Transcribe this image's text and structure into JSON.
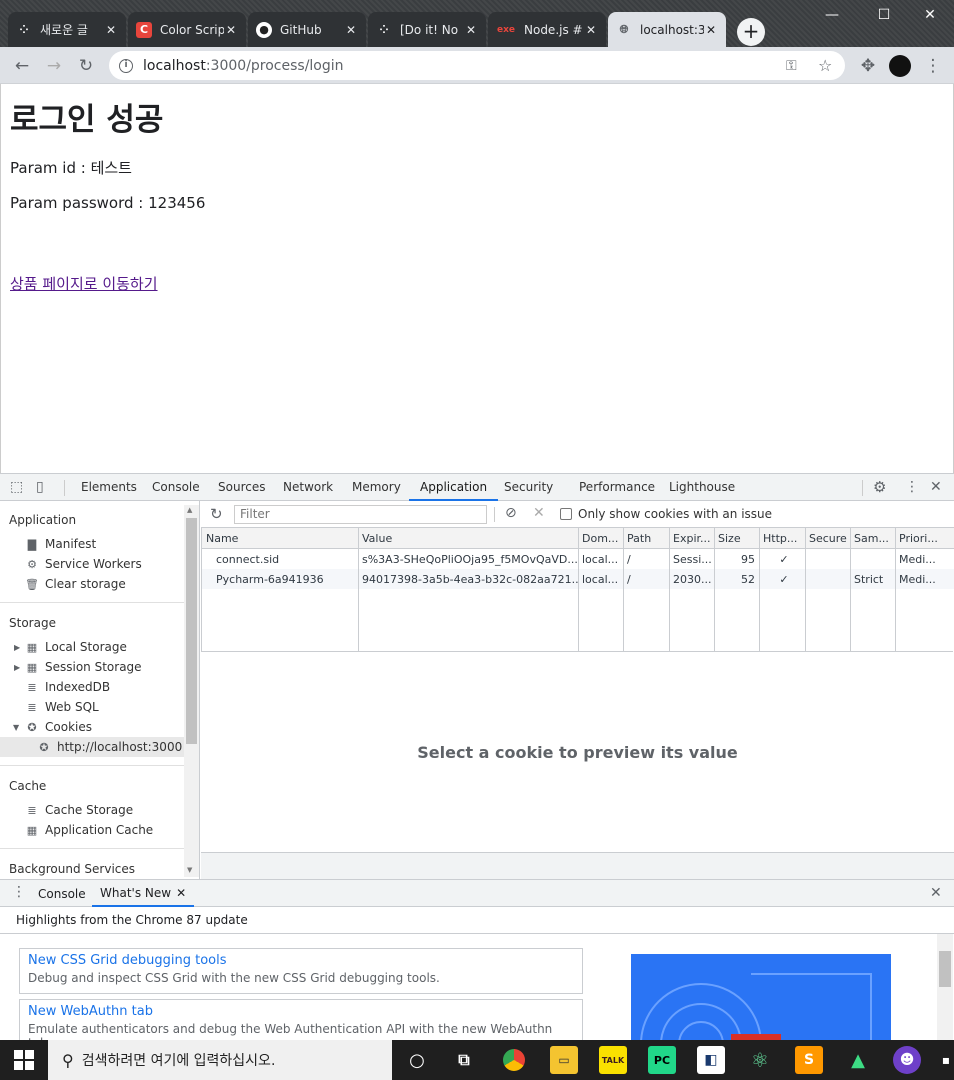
{
  "browser": {
    "tabs": [
      {
        "title": "새로운 글",
        "icon_name": "tistory-icon"
      },
      {
        "title": "Color Scrip",
        "icon_name": "colorscripter-icon"
      },
      {
        "title": "GitHub",
        "icon_name": "github-icon"
      },
      {
        "title": "[Do it! No",
        "icon_name": "tistory-icon"
      },
      {
        "title": "Node.js #",
        "icon_name": "exe-icon",
        "icon_text": "exe"
      },
      {
        "title": "localhost:3",
        "icon_name": "globe-icon",
        "active": true
      }
    ],
    "url_host": "localhost",
    "url_path": ":3000/process/login"
  },
  "page": {
    "heading": "로그인 성공",
    "param_id": "Param id : 테스트",
    "param_password": "Param password : 123456",
    "link": "상품 페이지로 이동하기"
  },
  "devtools": {
    "tabs": [
      "Elements",
      "Console",
      "Sources",
      "Network",
      "Memory",
      "Application",
      "Security",
      "Performance",
      "Lighthouse"
    ],
    "active_tab": "Application",
    "sidebar": {
      "application_title": "Application",
      "application_items": [
        "Manifest",
        "Service Workers",
        "Clear storage"
      ],
      "storage_title": "Storage",
      "storage_items": [
        "Local Storage",
        "Session Storage",
        "IndexedDB",
        "Web SQL",
        "Cookies"
      ],
      "cookie_origin": "http://localhost:3000",
      "cache_title": "Cache",
      "cache_items": [
        "Cache Storage",
        "Application Cache"
      ],
      "background_title": "Background Services"
    },
    "cookies": {
      "filter_placeholder": "Filter",
      "only_issue_label": "Only show cookies with an issue",
      "columns": [
        "Name",
        "Value",
        "Dom...",
        "Path",
        "Expir...",
        "Size",
        "Http...",
        "Secure",
        "Sam...",
        "Priori..."
      ],
      "rows": [
        [
          "connect.sid",
          "s%3A3-SHeQoPliOOja95_f5MOvQaVD...",
          "local...",
          "/",
          "Sessi...",
          "95",
          "✓",
          "",
          "",
          "Medi..."
        ],
        [
          "Pycharm-6a941936",
          "94017398-3a5b-4ea3-b32c-082aa721...",
          "local...",
          "/",
          "2030...",
          "52",
          "✓",
          "",
          "Strict",
          "Medi..."
        ]
      ],
      "preview_text": "Select a cookie to preview its value"
    },
    "drawer": {
      "tabs": [
        "Console",
        "What's New"
      ],
      "highlights": "Highlights from the Chrome 87 update",
      "cards": [
        {
          "title": "New CSS Grid debugging tools",
          "desc": "Debug and inspect CSS Grid with the new CSS Grid debugging tools."
        },
        {
          "title": "New WebAuthn tab",
          "desc": "Emulate authenticators and debug the Web Authentication API with the new WebAuthn tab."
        }
      ]
    }
  },
  "taskbar": {
    "search_placeholder": "검색하려면 여기에 입력하십시오."
  }
}
